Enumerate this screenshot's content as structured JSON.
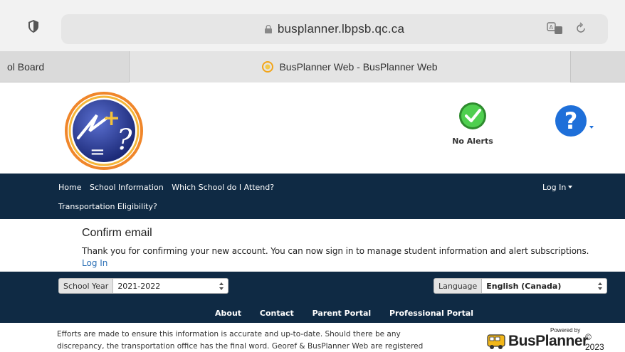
{
  "browser": {
    "url": "busplanner.lbpsb.qc.ca",
    "tabs": [
      {
        "label": "ol Board"
      },
      {
        "label": "BusPlanner Web - BusPlanner Web"
      }
    ]
  },
  "header": {
    "alerts_label": "No Alerts",
    "colors": {
      "alert_green": "#3fbf3f",
      "help_blue": "#1e6fd9"
    }
  },
  "nav": {
    "items": [
      "Home",
      "School Information",
      "Which School do I Attend?"
    ],
    "item_row2": "Transportation Eligibility?",
    "login_label": "Log In",
    "color": "#0f2a44"
  },
  "main": {
    "title": "Confirm email",
    "message": "Thank you for confirming your new account. You can now sign in to manage student information and alert subscriptions.",
    "link": "Log In"
  },
  "footer": {
    "school_year_label": "School Year",
    "school_year_value": "2021-2022",
    "language_label": "Language",
    "language_value": "English (Canada)",
    "links": [
      "About",
      "Contact",
      "Parent Portal",
      "Professional Portal"
    ],
    "disclaimer_line1": "Efforts are made to ensure this information is accurate and up-to-date. Should there be any",
    "disclaimer_line2": "discrepancy, the transportation office has the final word. Georef & BusPlanner Web are registered",
    "brand": {
      "powered_by": "Powered by",
      "name": "BusPlanner",
      "copyright": "©",
      "year": "2023"
    }
  }
}
